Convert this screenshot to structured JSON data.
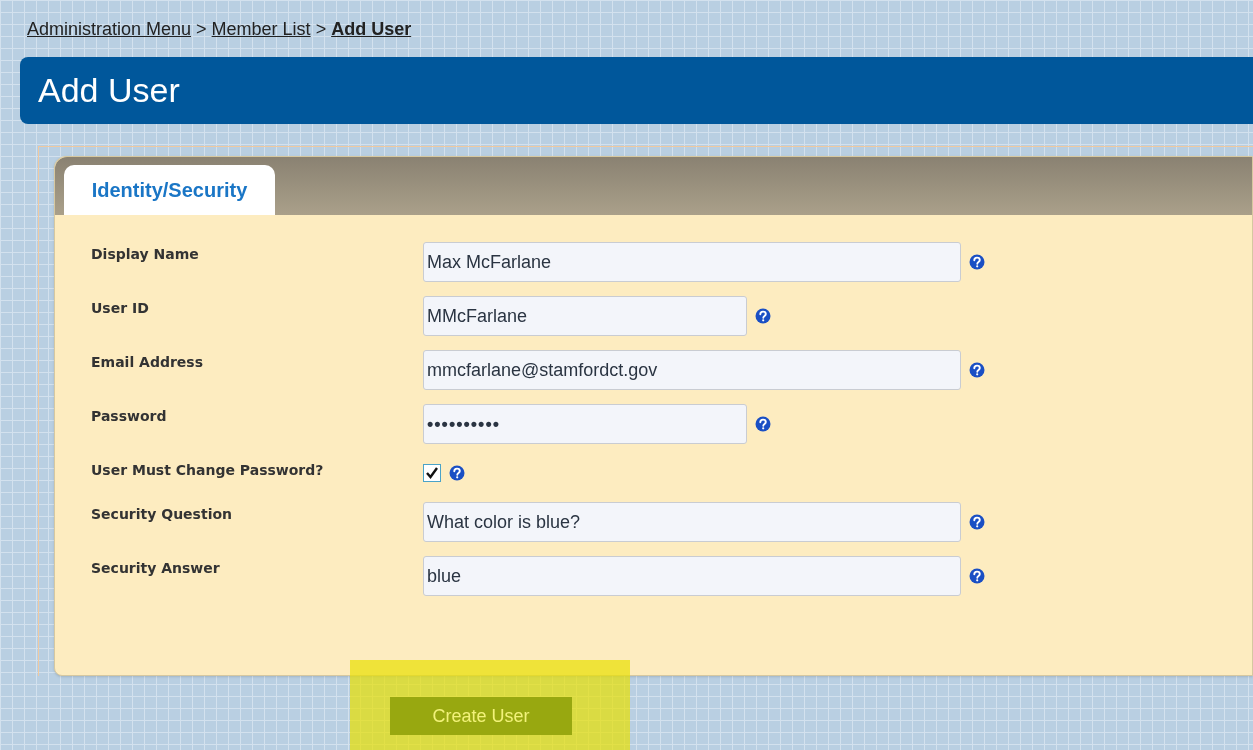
{
  "breadcrumb": [
    {
      "label": "Administration Menu",
      "current": false
    },
    {
      "label": "Member List",
      "current": false
    },
    {
      "label": "Add User",
      "current": true
    }
  ],
  "breadcrumb_separator": ">",
  "page_title": "Add User",
  "tabs": [
    {
      "label": "Identity/Security",
      "selected": true
    }
  ],
  "fields": [
    {
      "label": "Display Name",
      "kind": "long-text",
      "value": "Max McFarlane"
    },
    {
      "label": "User ID",
      "kind": "short-text",
      "value": "MMcFarlane"
    },
    {
      "label": "Email Address",
      "kind": "long-text",
      "value": "mmcfarlane@stamfordct.gov"
    },
    {
      "label": "Password",
      "kind": "password",
      "value": "••••••••••"
    },
    {
      "label": "User Must Change Password?",
      "kind": "checkbox",
      "checked": true
    },
    {
      "label": "Security Question",
      "kind": "long-text",
      "value": "What color is blue?"
    },
    {
      "label": "Security Answer",
      "kind": "long-text",
      "value": "blue"
    }
  ],
  "submit_button": {
    "label": "Create User",
    "highlighted": true
  }
}
